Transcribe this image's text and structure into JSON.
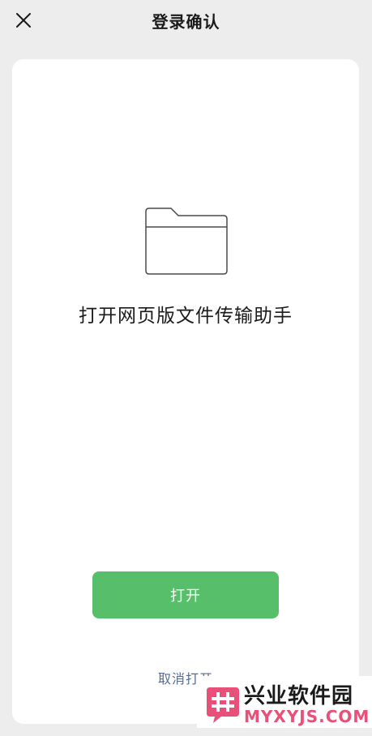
{
  "header": {
    "title": "登录确认",
    "close_icon": "close-icon"
  },
  "content": {
    "folder_icon": "folder-icon",
    "heading": "打开网页版文件传输助手"
  },
  "actions": {
    "open_label": "打开",
    "cancel_label": "取消打开",
    "accent_color": "#57be6a",
    "link_color": "#576b95"
  },
  "watermark": {
    "name": "兴业软件园",
    "domain": "MYXYJS.COM"
  }
}
